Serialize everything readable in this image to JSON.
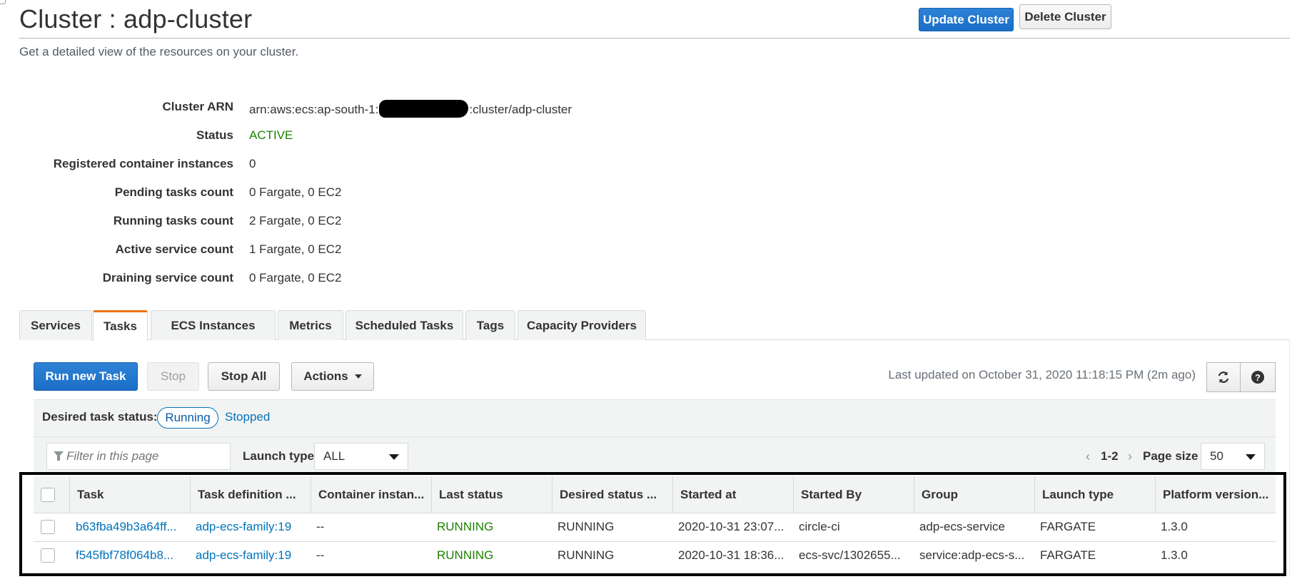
{
  "page": {
    "title": "Cluster : adp-cluster",
    "subtitle": "Get a detailed view of the resources on your cluster.",
    "update_button": "Update Cluster",
    "delete_button": "Delete Cluster"
  },
  "details": [
    {
      "label": "Cluster ARN",
      "value_prefix": "arn:aws:ecs:ap-south-1:",
      "value_suffix": ":cluster/adp-cluster"
    },
    {
      "label": "Status",
      "value": "ACTIVE"
    },
    {
      "label": "Registered container instances",
      "value": "0"
    },
    {
      "label": "Pending tasks count",
      "value": "0 Fargate, 0 EC2"
    },
    {
      "label": "Running tasks count",
      "value": "2 Fargate, 0 EC2"
    },
    {
      "label": "Active service count",
      "value": "1 Fargate, 0 EC2"
    },
    {
      "label": "Draining service count",
      "value": "0 Fargate, 0 EC2"
    }
  ],
  "tabs": [
    "Services",
    "Tasks",
    "ECS Instances",
    "Metrics",
    "Scheduled Tasks",
    "Tags",
    "Capacity Providers"
  ],
  "active_tab": "Tasks",
  "toolbar": {
    "run_new_task": "Run new Task",
    "stop": "Stop",
    "stop_all": "Stop All",
    "actions": "Actions",
    "last_updated": "Last updated on October 31, 2020 11:18:15 PM (2m ago)",
    "refresh_icon": "refresh-icon",
    "help_icon": "help-icon"
  },
  "status_filter": {
    "label": "Desired task status:",
    "running": "Running",
    "stopped": "Stopped"
  },
  "filter": {
    "placeholder": "Filter in this page",
    "launch_type_label": "Launch type",
    "launch_type_value": "ALL",
    "range": "1-2",
    "page_size_label": "Page size",
    "page_size_value": "50"
  },
  "table": {
    "columns": [
      "Task",
      "Task definition ...",
      "Container instan...",
      "Last status",
      "Desired status ...",
      "Started at",
      "Started By",
      "Group",
      "Launch type",
      "Platform version..."
    ],
    "rows": [
      [
        "b63fba49b3a64ff...",
        "adp-ecs-family:19",
        "--",
        "RUNNING",
        "RUNNING",
        "2020-10-31 23:07...",
        "circle-ci",
        "adp-ecs-service",
        "FARGATE",
        "1.3.0"
      ],
      [
        "f545fbf78f064b8...",
        "adp-ecs-family:19",
        "--",
        "RUNNING",
        "RUNNING",
        "2020-10-31 18:36...",
        "ecs-svc/1302655...",
        "service:adp-ecs-s...",
        "FARGATE",
        "1.3.0"
      ]
    ]
  },
  "colors": {
    "primary": "#1a6ec6",
    "link": "#0073bb",
    "success": "#1d8102",
    "tab_accent": "#ec7211"
  }
}
